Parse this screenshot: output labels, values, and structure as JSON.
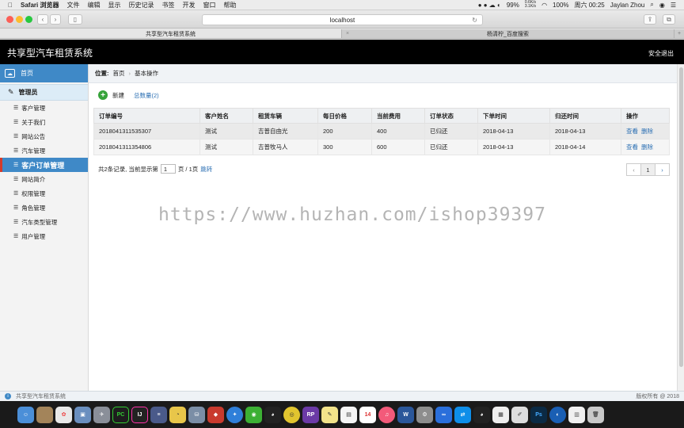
{
  "menubar": {
    "apple": "",
    "app_name": "Safari 浏览器",
    "menus": [
      "文件",
      "编辑",
      "显示",
      "历史记录",
      "书签",
      "开发",
      "窗口",
      "帮助"
    ],
    "battery_pct": "99%",
    "net_up": "0.6K/s",
    "net_down": "3.1K/s",
    "battery2": "100%",
    "clock": "周六 00:25",
    "user": "Jaylan Zhou"
  },
  "browser": {
    "address": "localhost",
    "tabs": [
      "共享型汽车租赁系统",
      "杨清柠_百度搜索"
    ]
  },
  "header": {
    "title": "共享型汽车租赁系统",
    "logout": "安全退出"
  },
  "sidebar": {
    "home": "首页",
    "group": "管理员",
    "items": [
      "客户管理",
      "关于我们",
      "网站公告",
      "汽车管理",
      "客户订单管理",
      "网站简介",
      "权限管理",
      "角色管理",
      "汽车类型管理",
      "用户管理"
    ],
    "active_index": 4
  },
  "breadcrumb": {
    "label": "位置:",
    "home": "首页",
    "sep": "›",
    "current": "基本操作"
  },
  "actions": {
    "new": "新建",
    "count": "总数量(2)"
  },
  "table": {
    "headers": [
      "订单编号",
      "客户姓名",
      "租赁车辆",
      "每日价格",
      "当前费用",
      "订单状态",
      "下单时间",
      "归还时间",
      "操作"
    ],
    "rows": [
      [
        "2018041311535307",
        "测试",
        "吉普自由光",
        "200",
        "400",
        "已归还",
        "2018-04-13",
        "2018-04-13"
      ],
      [
        "2018041311354806",
        "测试",
        "吉普牧马人",
        "300",
        "600",
        "已归还",
        "2018-04-13",
        "2018-04-14"
      ]
    ],
    "op_view": "查看",
    "op_delete": "删除"
  },
  "pagination": {
    "prefix": "共2条记录,  当前显示第",
    "page_value": "1",
    "suffix": "页 / 1页",
    "jump": "跳转",
    "prev": "‹",
    "current": "1",
    "next": "›"
  },
  "watermark": "https://www.huzhan.com/ishop39397",
  "status": {
    "left": "共享型汽车租赁系统",
    "right": "版权所有 @ 2018"
  },
  "dock": {
    "icons": [
      "finder-icon",
      "notes-icon",
      "photos-icon",
      "preview-icon",
      "launchpad-icon",
      "pycharm-icon",
      "intellij-icon",
      "sublime-icon",
      "cyberduck-icon",
      "db-icon",
      "redis-icon",
      "safari-icon",
      "wechat-icon",
      "qq-icon",
      "chrome-icon",
      "rp-icon",
      "note-icon",
      "stickies-icon",
      "calendar-icon",
      "music-icon",
      "word-icon",
      "prefs-icon",
      "baidu-icon",
      "teamviewer-icon",
      "qq2-icon",
      "pages-icon",
      "typora-icon",
      "photoshop-icon",
      "vpn-icon",
      "doc-icon",
      "trash-icon"
    ],
    "calendar_day": "14"
  },
  "colors": {
    "accent": "#3f89c7",
    "link": "#2b6fb3",
    "header_bg": "#000000"
  }
}
